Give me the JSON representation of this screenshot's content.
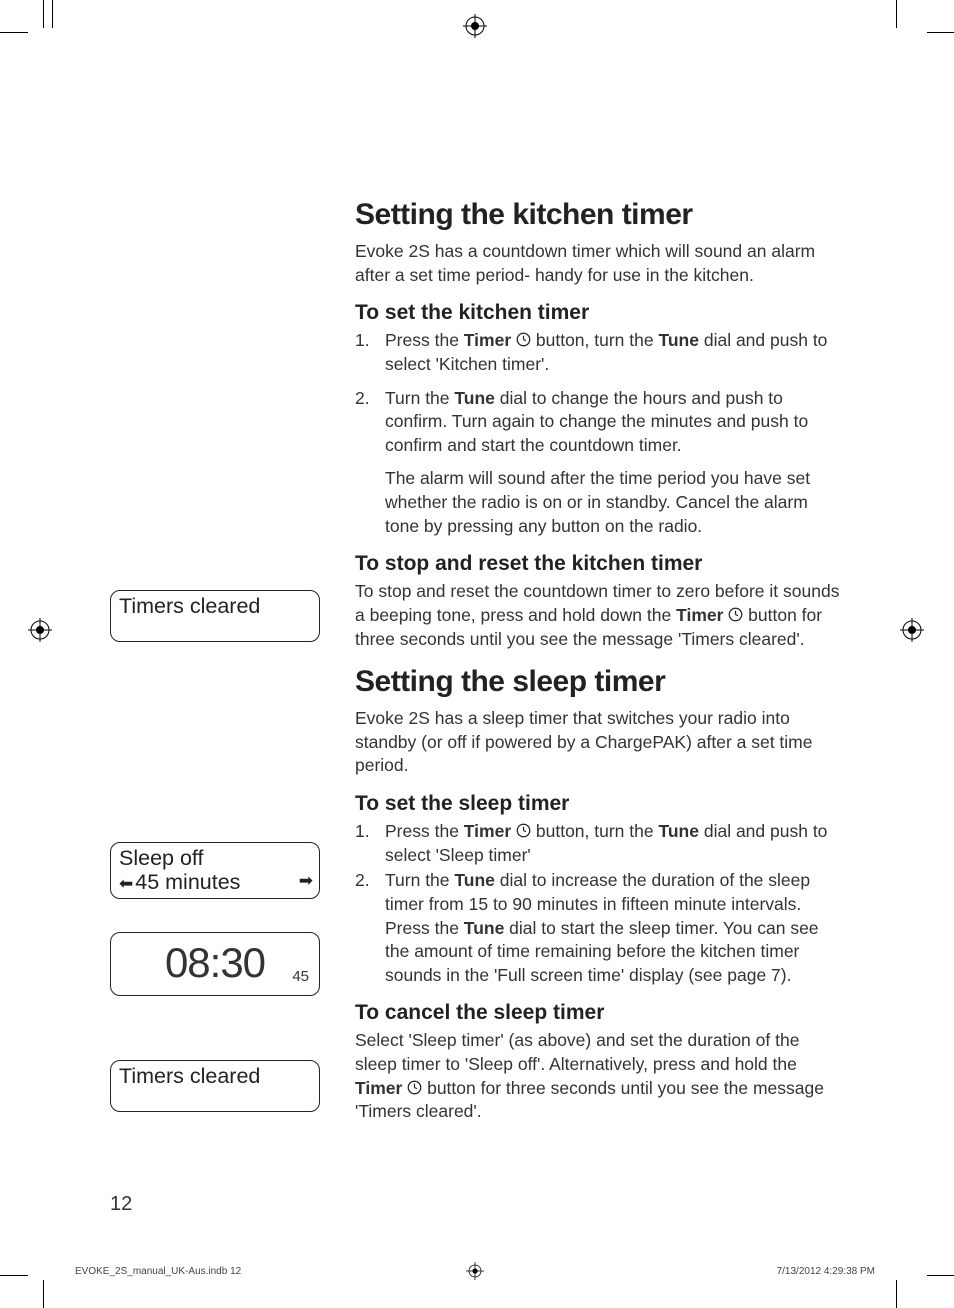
{
  "headings": {
    "h1_kitchen": "Setting the kitchen timer",
    "h1_sleep": "Setting the sleep timer",
    "h2_set_kitchen": "To set the kitchen timer",
    "h2_stop_kitchen": "To stop and reset the kitchen timer",
    "h2_set_sleep": "To set the sleep timer",
    "h2_cancel_sleep": "To cancel the sleep timer"
  },
  "paras": {
    "intro_kitchen": "Evoke 2S has a countdown timer which will sound an alarm after a set time period- handy for use in the kitchen.",
    "kitchen_step1_a": "Press the ",
    "kitchen_step1_b": " button,  turn the ",
    "kitchen_step1_c": " dial and push to select 'Kitchen timer'.",
    "kitchen_step2_a": "Turn the ",
    "kitchen_step2_b": " dial to change the hours and push to confirm. Turn again to change the minutes and push to confirm and start the countdown timer.",
    "kitchen_step2_sub": "The alarm will sound after the time period you have set whether the radio is on or in standby. Cancel the alarm tone by pressing any button on the radio.",
    "stop_kitchen_a": "To stop and reset the countdown timer to zero before it sounds a beeping tone, press and hold down the ",
    "stop_kitchen_b": " button for three seconds until you see the message 'Timers cleared'.",
    "intro_sleep": "Evoke 2S has a sleep timer that switches your radio into standby (or off if powered by a ChargePAK) after a set time period.",
    "sleep_step1_a": "Press the ",
    "sleep_step1_b": " button, turn the ",
    "sleep_step1_c": " dial and push to select 'Sleep timer'",
    "sleep_step2_a": "Turn the ",
    "sleep_step2_b": " dial to increase the duration of the sleep timer from 15 to 90 minutes in fifteen minute intervals. Press the ",
    "sleep_step2_c": " dial to start the sleep timer. You can see the amount of time remaining before the kitchen timer sounds in the 'Full screen time' display (see page 7).",
    "cancel_sleep_a": "Select 'Sleep timer' (as above) and set the duration of the sleep timer to 'Sleep off'. Alternatively, press and hold the ",
    "cancel_sleep_b": " button for three seconds until you see the message 'Timers cleared'."
  },
  "bold": {
    "timer": "Timer",
    "tune": "Tune"
  },
  "lcd": {
    "timers_cleared": "Timers cleared",
    "sleep_off": "Sleep off",
    "minutes": "45 minutes",
    "time": "08:30",
    "time_small": "45"
  },
  "list_num": {
    "one": "1.",
    "two": "2."
  },
  "page_number": "12",
  "footer": {
    "file": "EVOKE_2S_manual_UK-Aus.indb   12",
    "date": "7/13/2012   4:29:38 PM"
  }
}
